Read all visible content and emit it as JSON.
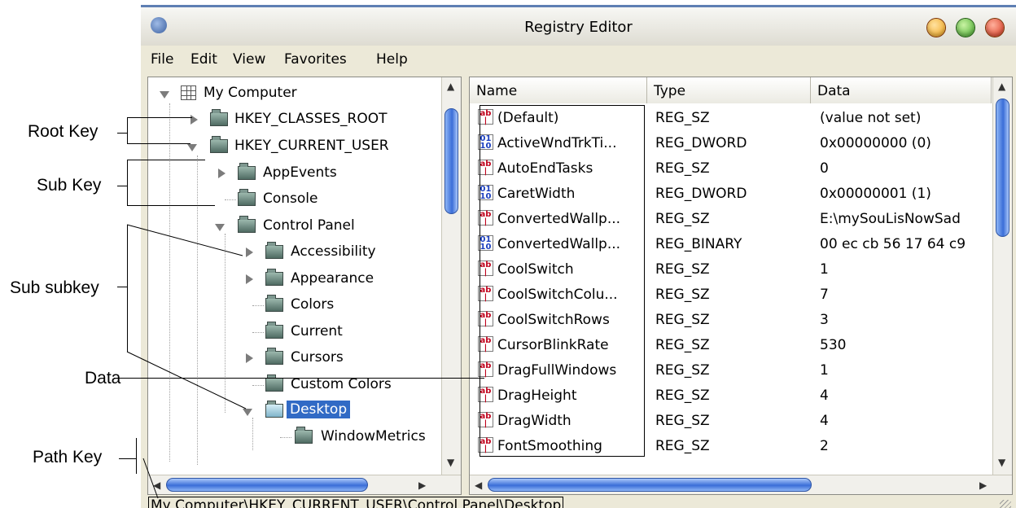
{
  "annotations": {
    "root_key": "Root Key",
    "sub_key": "Sub Key",
    "sub_subkey": "Sub subkey",
    "data": "Data",
    "path_key": "Path Key"
  },
  "window": {
    "title": "Registry Editor",
    "buttons": [
      "minimize",
      "maximize",
      "close"
    ]
  },
  "menu": [
    "File",
    "Edit",
    "View",
    "Favorites",
    "Help"
  ],
  "tree": [
    {
      "label": "My Computer",
      "depth": 0,
      "state": "expanded",
      "icon": "computer-icon"
    },
    {
      "label": "HKEY_CLASSES_ROOT",
      "depth": 1,
      "state": "collapsed",
      "icon": "folder-icon"
    },
    {
      "label": "HKEY_CURRENT_USER",
      "depth": 1,
      "state": "expanded",
      "icon": "folder-icon"
    },
    {
      "label": "AppEvents",
      "depth": 2,
      "state": "collapsed",
      "icon": "folder-icon"
    },
    {
      "label": "Console",
      "depth": 2,
      "state": "leaf",
      "icon": "folder-icon"
    },
    {
      "label": "Control Panel",
      "depth": 2,
      "state": "expanded",
      "icon": "folder-icon"
    },
    {
      "label": "Accessibility",
      "depth": 3,
      "state": "collapsed",
      "icon": "folder-icon"
    },
    {
      "label": "Appearance",
      "depth": 3,
      "state": "collapsed",
      "icon": "folder-icon"
    },
    {
      "label": "Colors",
      "depth": 3,
      "state": "leaf",
      "icon": "folder-icon"
    },
    {
      "label": "Current",
      "depth": 3,
      "state": "leaf",
      "icon": "folder-icon"
    },
    {
      "label": "Cursors",
      "depth": 3,
      "state": "collapsed",
      "icon": "folder-icon"
    },
    {
      "label": "Custom Colors",
      "depth": 3,
      "state": "leaf",
      "icon": "folder-icon"
    },
    {
      "label": "Desktop",
      "depth": 3,
      "state": "expanded",
      "icon": "open-folder-icon",
      "selected": true
    },
    {
      "label": "WindowMetrics",
      "depth": 4,
      "state": "leaf",
      "icon": "folder-icon"
    }
  ],
  "list": {
    "columns": [
      "Name",
      "Type",
      "Data"
    ],
    "rows": [
      {
        "name": "(Default)",
        "type": "REG_SZ",
        "data": "(value not set)",
        "icon": "string-value-icon"
      },
      {
        "name": "ActiveWndTrkTi...",
        "type": "REG_DWORD",
        "data": "0x00000000 (0)",
        "icon": "binary-value-icon"
      },
      {
        "name": "AutoEndTasks",
        "type": "REG_SZ",
        "data": "0",
        "icon": "string-value-icon"
      },
      {
        "name": "CaretWidth",
        "type": "REG_DWORD",
        "data": "0x00000001 (1)",
        "icon": "binary-value-icon"
      },
      {
        "name": "ConvertedWallp...",
        "type": "REG_SZ",
        "data": "E:\\mySouLisNowSad",
        "icon": "string-value-icon"
      },
      {
        "name": "ConvertedWallp...",
        "type": "REG_BINARY",
        "data": "00 ec cb 56 17 64 c9",
        "icon": "binary-value-icon"
      },
      {
        "name": "CoolSwitch",
        "type": "REG_SZ",
        "data": "1",
        "icon": "string-value-icon"
      },
      {
        "name": "CoolSwitchColu...",
        "type": "REG_SZ",
        "data": "7",
        "icon": "string-value-icon"
      },
      {
        "name": "CoolSwitchRows",
        "type": "REG_SZ",
        "data": "3",
        "icon": "string-value-icon"
      },
      {
        "name": "CursorBlinkRate",
        "type": "REG_SZ",
        "data": "530",
        "icon": "string-value-icon"
      },
      {
        "name": "DragFullWindows",
        "type": "REG_SZ",
        "data": "1",
        "icon": "string-value-icon"
      },
      {
        "name": "DragHeight",
        "type": "REG_SZ",
        "data": "4",
        "icon": "string-value-icon"
      },
      {
        "name": "DragWidth",
        "type": "REG_SZ",
        "data": "4",
        "icon": "string-value-icon"
      },
      {
        "name": "FontSmoothing",
        "type": "REG_SZ",
        "data": "2",
        "icon": "string-value-icon"
      }
    ]
  },
  "status": {
    "path": "My Computer\\HKEY_CURRENT_USER\\Control Panel\\Desktop"
  },
  "colors": {
    "selection": "#316ac5",
    "scroll_thumb": "#3b6ed8",
    "window_bg": "#ece9d8"
  }
}
